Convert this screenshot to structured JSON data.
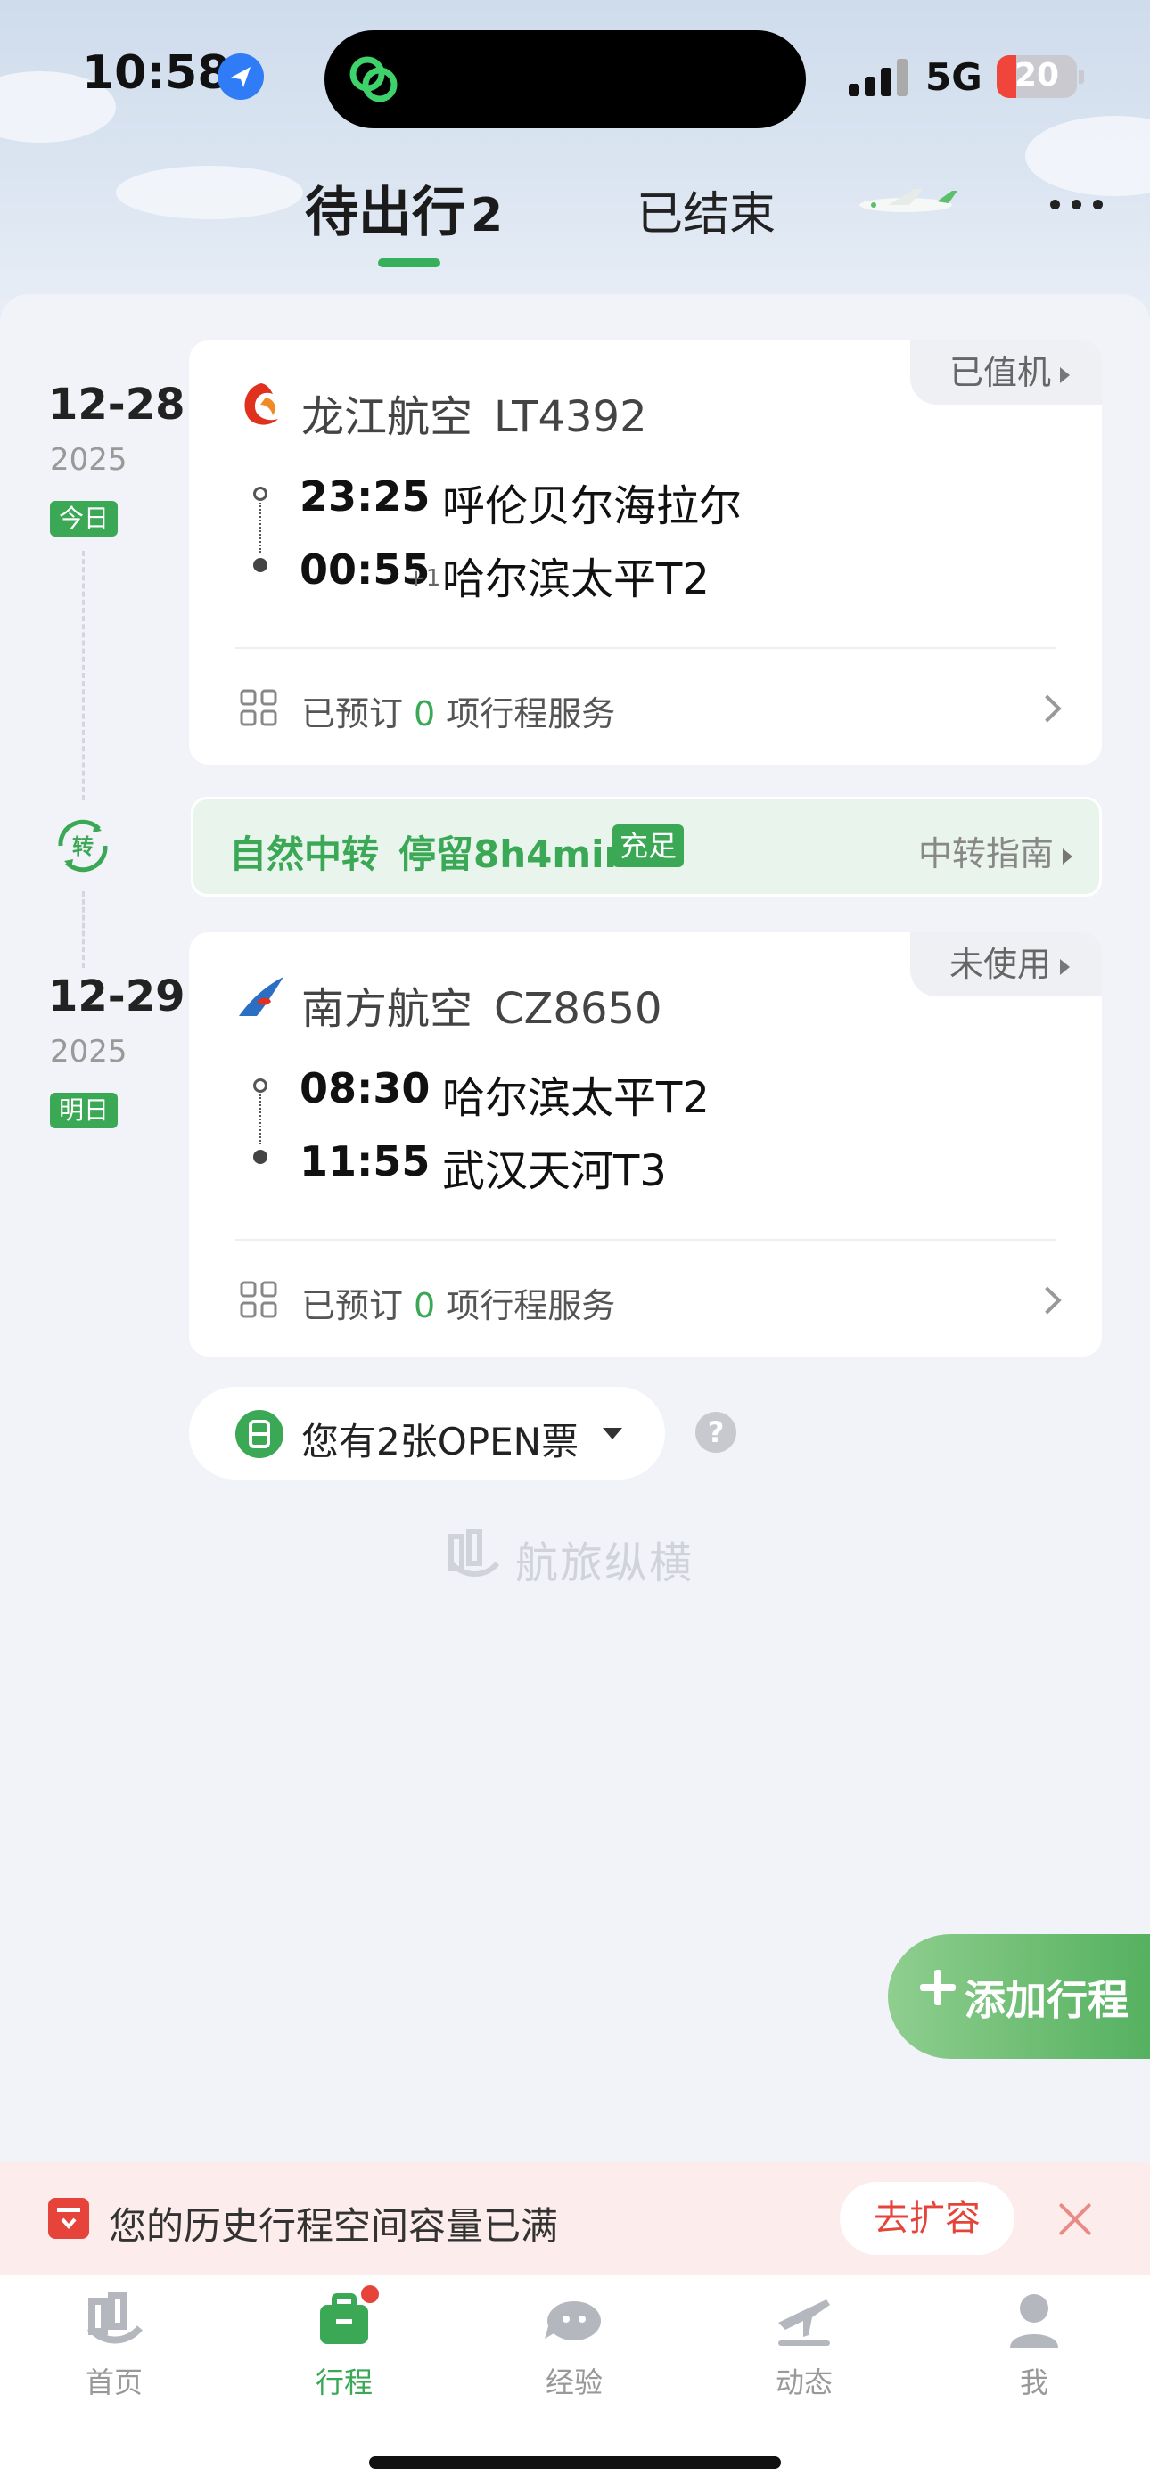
{
  "status_bar": {
    "time": "10:58",
    "network": "5G",
    "battery": "20"
  },
  "tabs": {
    "active_label": "待出行",
    "active_count": "2",
    "other_label": "已结束"
  },
  "flights": [
    {
      "date": "12-28",
      "year": "2025",
      "day_tag": "今日",
      "status": "已值机",
      "airline": "龙江航空",
      "flight_no": "LT4392",
      "dep_time": "23:25",
      "dep_place": "呼伦贝尔海拉尔",
      "arr_time": "00:55",
      "arr_plus": "+1",
      "arr_place": "哈尔滨太平T2",
      "svc_prefix": "已预订",
      "svc_count": "0",
      "svc_suffix": "项行程服务"
    },
    {
      "date": "12-29",
      "year": "2025",
      "day_tag": "明日",
      "status": "未使用",
      "airline": "南方航空",
      "flight_no": "CZ8650",
      "dep_time": "08:30",
      "dep_place": "哈尔滨太平T2",
      "arr_time": "11:55",
      "arr_place": "武汉天河T3",
      "svc_prefix": "已预订",
      "svc_count": "0",
      "svc_suffix": "项行程服务"
    }
  ],
  "transfer": {
    "icon_label": "转",
    "type": "自然中转",
    "stay": "停留8h4min",
    "tag": "充足",
    "guide": "中转指南"
  },
  "open_ticket": {
    "label": "您有2张OPEN票"
  },
  "watermark": "航旅纵横",
  "add_trip": {
    "label": "添加行程"
  },
  "banner": {
    "text": "您的历史行程空间容量已满",
    "button": "去扩容"
  },
  "tabbar": {
    "items": [
      {
        "label": "首页",
        "icon": "home-icon"
      },
      {
        "label": "行程",
        "icon": "trip-briefcase-icon"
      },
      {
        "label": "经验",
        "icon": "experience-icon"
      },
      {
        "label": "动态",
        "icon": "flight-status-icon"
      },
      {
        "label": "我",
        "icon": "profile-icon"
      }
    ]
  },
  "colors": {
    "accent": "#3ba856",
    "alert": "#e6443b"
  }
}
